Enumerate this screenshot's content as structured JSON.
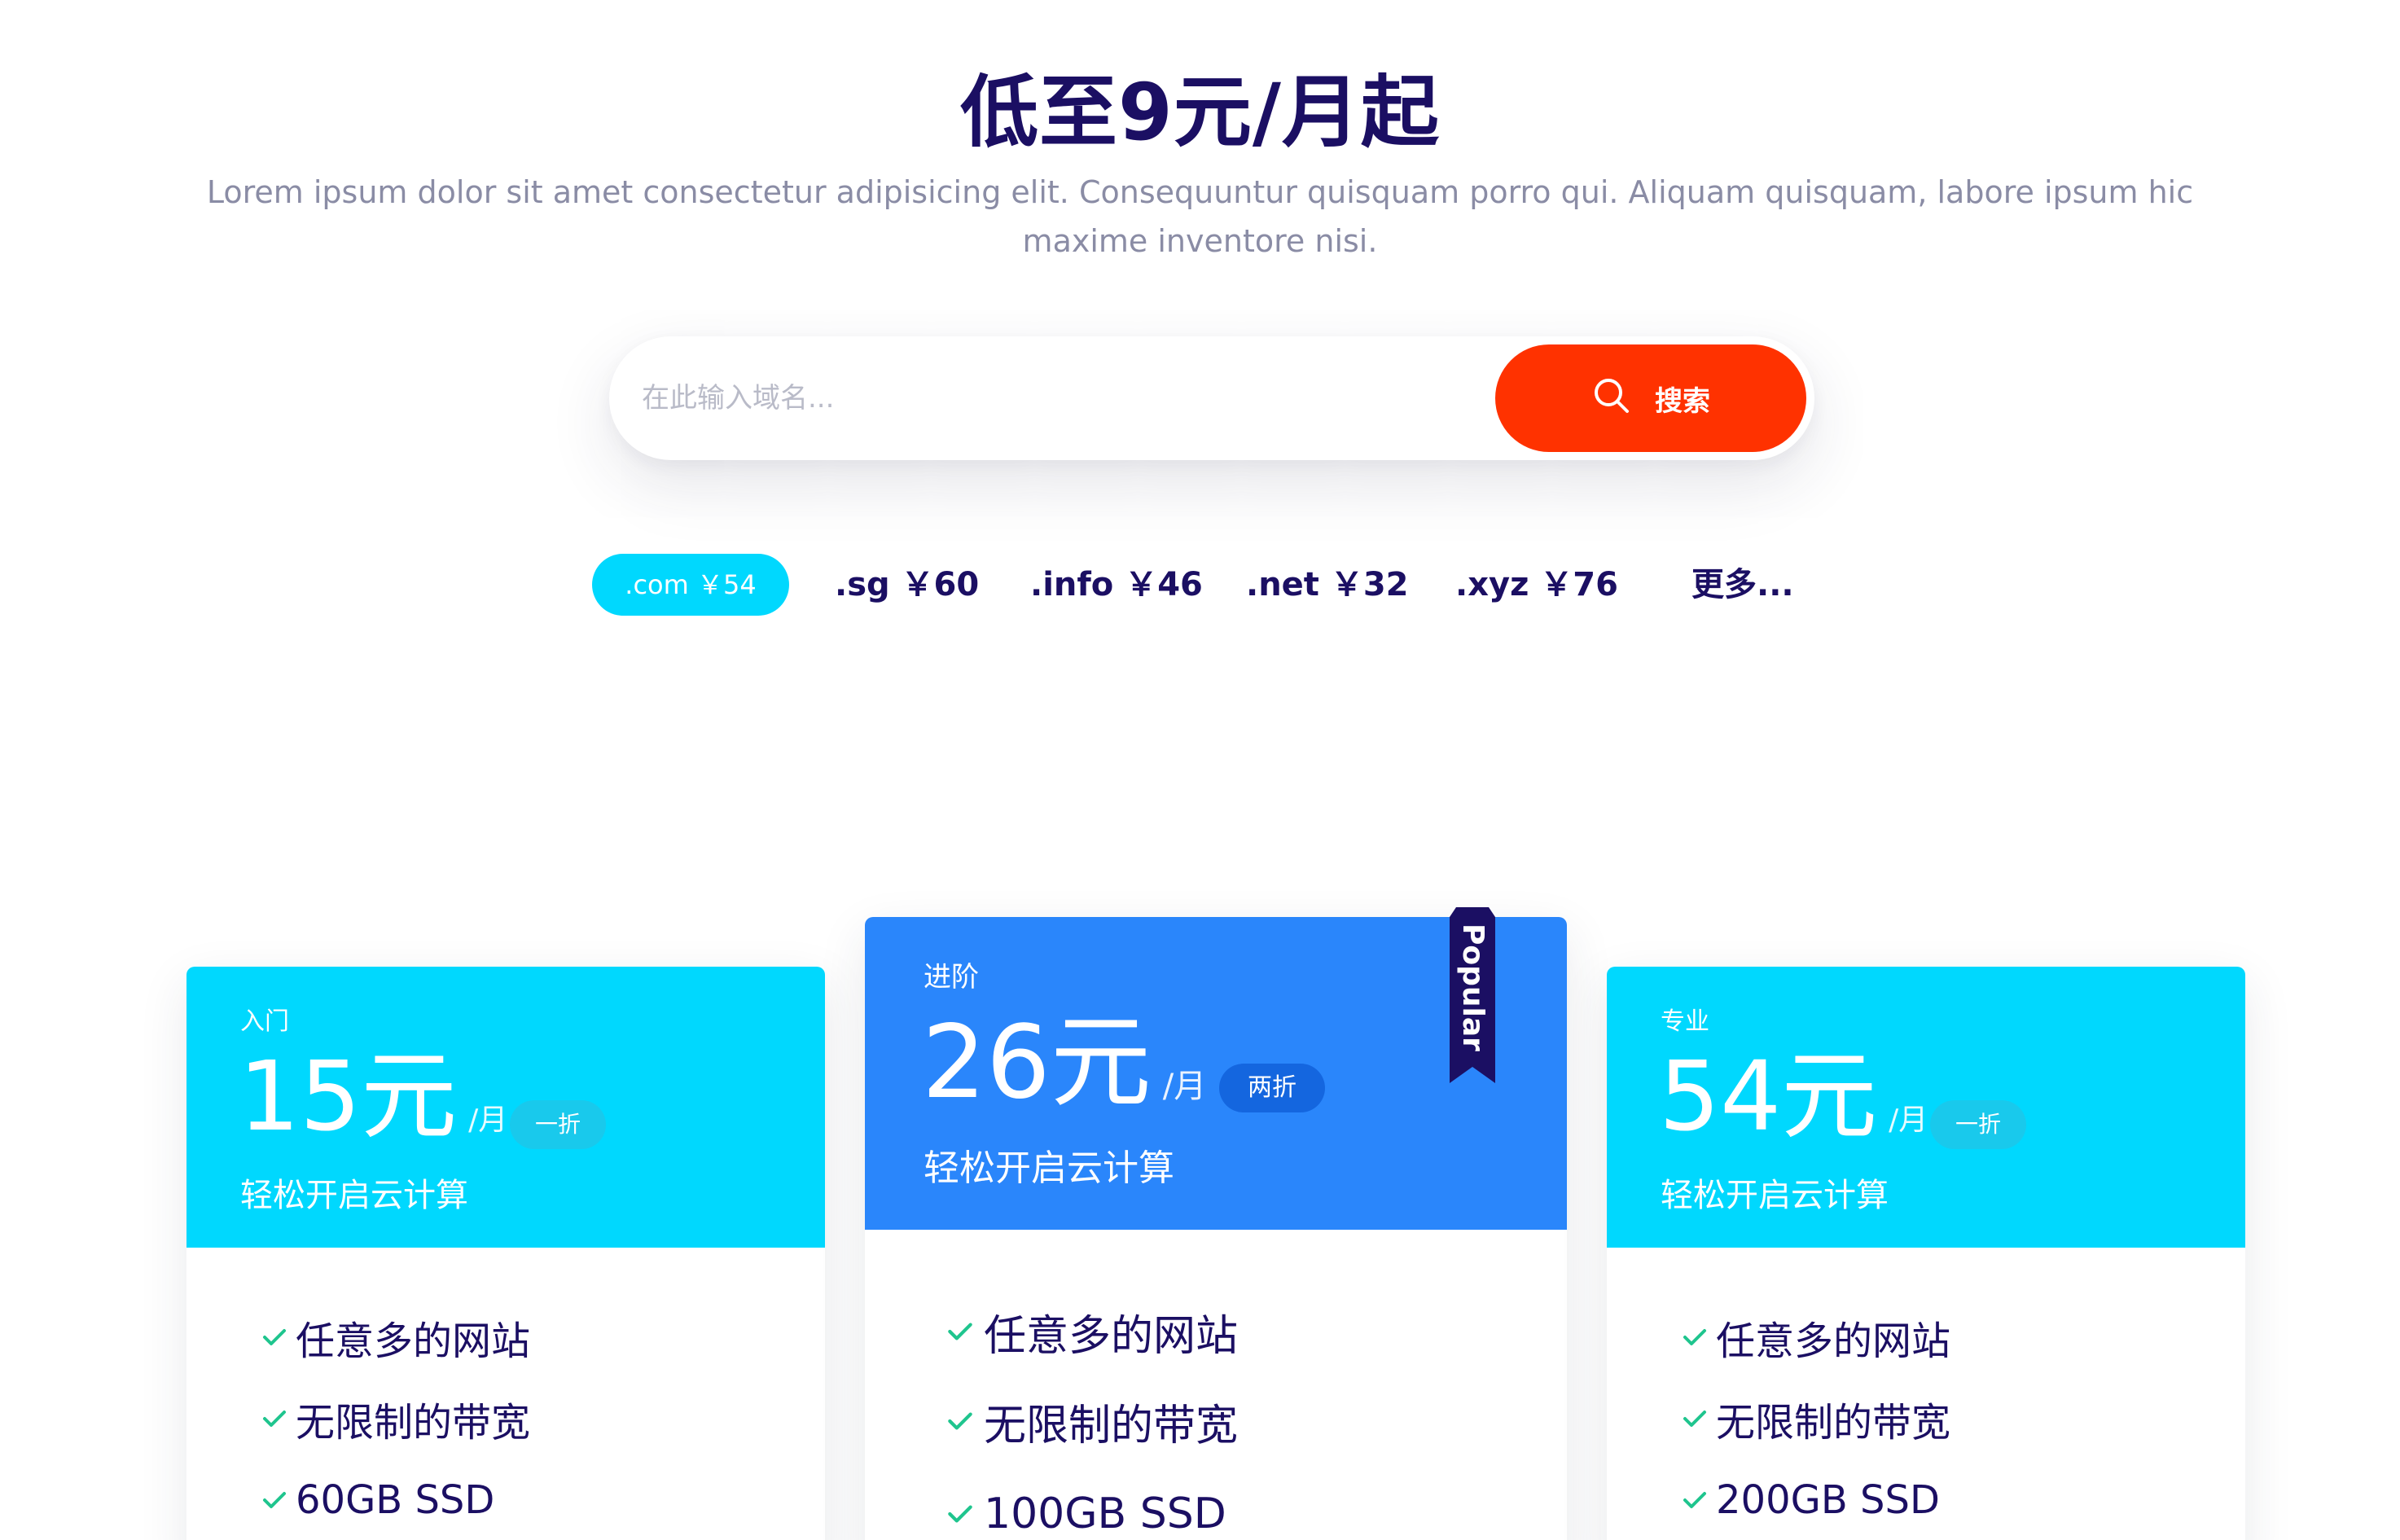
{
  "hero": {
    "title": "低至9元/月起",
    "subtitle": "Lorem ipsum dolor sit amet consectetur adipisicing elit. Consequuntur quisquam porro qui. Aliquam quisquam, labore ipsum hic maxime inventore nisi."
  },
  "search": {
    "placeholder": "在此输入域名...",
    "button_label": "搜索",
    "button_icon": "search-icon",
    "button_color": "#ff3200"
  },
  "domains": [
    {
      "label": ".com ￥54",
      "active": true
    },
    {
      "label": ".sg ￥60",
      "active": false
    },
    {
      "label": ".info ￥46",
      "active": false
    },
    {
      "label": ".net ￥32",
      "active": false
    },
    {
      "label": ".xyz ￥76",
      "active": false
    },
    {
      "label": "更多...",
      "active": false
    }
  ],
  "plans": [
    {
      "tier": "入门",
      "price": "15元",
      "period": "/月",
      "badge": "一折",
      "desc": "轻松开启云计算",
      "color": "#00d8fe",
      "features": [
        "任意多的网站",
        "无限制的带宽",
        "60GB SSD"
      ]
    },
    {
      "tier": "进阶",
      "price": "26元",
      "period": "/月",
      "badge": "两折",
      "desc": "轻松开启云计算",
      "color": "#2a86fb",
      "ribbon": "Popular",
      "features": [
        "任意多的网站",
        "无限制的带宽",
        "100GB SSD"
      ]
    },
    {
      "tier": "专业",
      "price": "54元",
      "period": "/月",
      "badge": "一折",
      "desc": "轻松开启云计算",
      "color": "#00d8fe",
      "features": [
        "任意多的网站",
        "无限制的带宽",
        "200GB SSD"
      ]
    }
  ],
  "colors": {
    "title": "#1b0f63",
    "check": "#1fc58e",
    "ribbon": "#1b0f63",
    "domain_active": "#00d8fe"
  }
}
